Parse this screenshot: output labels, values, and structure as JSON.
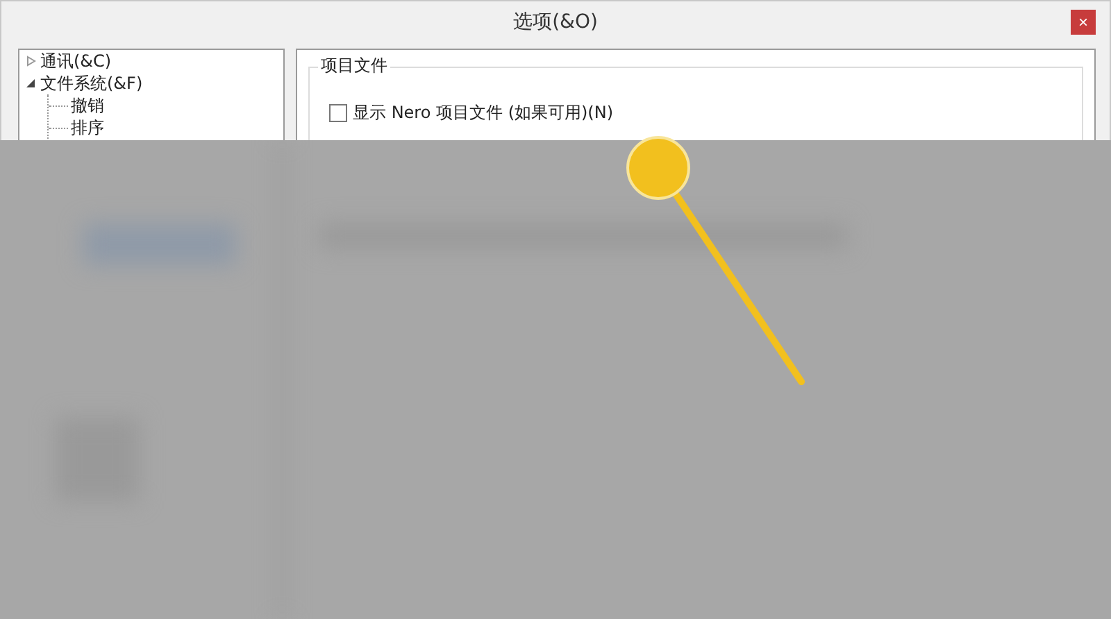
{
  "window": {
    "title": "选项(&O)",
    "close": "×"
  },
  "tree": [
    {
      "label": "通讯(&C)",
      "expanded": false
    },
    {
      "label": "文件系统(&F)",
      "expanded": true,
      "children": [
        {
          "label": "撤销"
        },
        {
          "label": "排序"
        }
      ]
    }
  ],
  "group": {
    "title": "项目文件",
    "checkbox": {
      "label": "显示 Nero 项目文件 (如果可用)(N)",
      "checked": false
    }
  }
}
